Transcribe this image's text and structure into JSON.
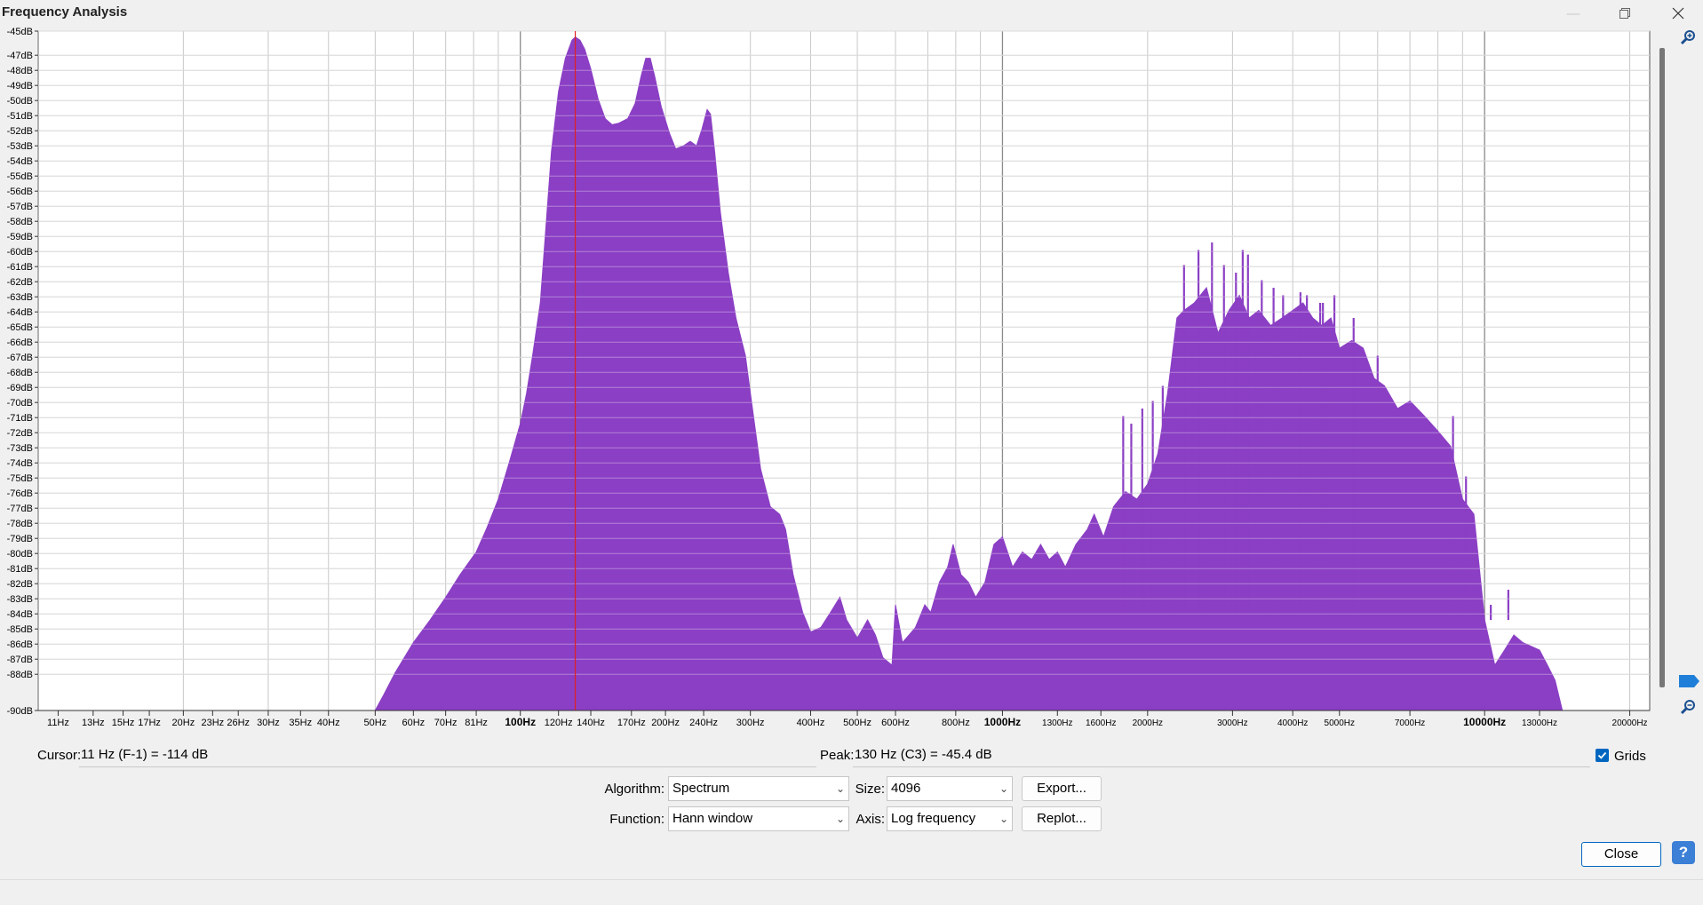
{
  "window": {
    "title": "Frequency Analysis",
    "minimize_icon": "minimize-icon",
    "restore_icon": "restore-icon",
    "close_icon": "close-icon"
  },
  "chart_data": {
    "type": "area",
    "xscale": "log",
    "xlim": [
      10,
      22000
    ],
    "ylim": [
      -90,
      -45
    ],
    "grid": true,
    "fill_color": "#8b3fc4",
    "cursor_color": "#e02020",
    "cursor_x": 130,
    "x_ticks": [
      {
        "v": 11,
        "label": "11Hz",
        "major": false
      },
      {
        "v": 13,
        "label": "13Hz",
        "major": false
      },
      {
        "v": 15,
        "label": "15Hz",
        "major": false
      },
      {
        "v": 17,
        "label": "17Hz",
        "major": false
      },
      {
        "v": 20,
        "label": "20Hz",
        "major": false
      },
      {
        "v": 23,
        "label": "23Hz",
        "major": false
      },
      {
        "v": 26,
        "label": "26Hz",
        "major": false
      },
      {
        "v": 30,
        "label": "30Hz",
        "major": false
      },
      {
        "v": 35,
        "label": "35Hz",
        "major": false
      },
      {
        "v": 40,
        "label": "40Hz",
        "major": false
      },
      {
        "v": 50,
        "label": "50Hz",
        "major": false
      },
      {
        "v": 60,
        "label": "60Hz",
        "major": false
      },
      {
        "v": 70,
        "label": "70Hz",
        "major": false
      },
      {
        "v": 81,
        "label": "81Hz",
        "major": false
      },
      {
        "v": 100,
        "label": "100Hz",
        "major": true
      },
      {
        "v": 120,
        "label": "120Hz",
        "major": false
      },
      {
        "v": 140,
        "label": "140Hz",
        "major": false
      },
      {
        "v": 170,
        "label": "170Hz",
        "major": false
      },
      {
        "v": 200,
        "label": "200Hz",
        "major": false
      },
      {
        "v": 240,
        "label": "240Hz",
        "major": false
      },
      {
        "v": 300,
        "label": "300Hz",
        "major": false
      },
      {
        "v": 400,
        "label": "400Hz",
        "major": false
      },
      {
        "v": 500,
        "label": "500Hz",
        "major": false
      },
      {
        "v": 600,
        "label": "600Hz",
        "major": false
      },
      {
        "v": 800,
        "label": "800Hz",
        "major": false
      },
      {
        "v": 1000,
        "label": "1000Hz",
        "major": true
      },
      {
        "v": 1300,
        "label": "1300Hz",
        "major": false
      },
      {
        "v": 1600,
        "label": "1600Hz",
        "major": false
      },
      {
        "v": 2000,
        "label": "2000Hz",
        "major": false
      },
      {
        "v": 3000,
        "label": "3000Hz",
        "major": false
      },
      {
        "v": 4000,
        "label": "4000Hz",
        "major": false
      },
      {
        "v": 5000,
        "label": "5000Hz",
        "major": false
      },
      {
        "v": 7000,
        "label": "7000Hz",
        "major": false
      },
      {
        "v": 10000,
        "label": "10000Hz",
        "major": true
      },
      {
        "v": 13000,
        "label": "13000Hz",
        "major": false
      },
      {
        "v": 20000,
        "label": "20000Hz",
        "major": false
      }
    ],
    "y_ticks": [
      "-45dB",
      "-47dB",
      "-48dB",
      "-49dB",
      "-50dB",
      "-51dB",
      "-52dB",
      "-53dB",
      "-54dB",
      "-55dB",
      "-56dB",
      "-57dB",
      "-58dB",
      "-59dB",
      "-60dB",
      "-61dB",
      "-62dB",
      "-63dB",
      "-64dB",
      "-65dB",
      "-66dB",
      "-67dB",
      "-68dB",
      "-69dB",
      "-70dB",
      "-71dB",
      "-72dB",
      "-73dB",
      "-74dB",
      "-75dB",
      "-76dB",
      "-77dB",
      "-78dB",
      "-79dB",
      "-80dB",
      "-81dB",
      "-82dB",
      "-83dB",
      "-84dB",
      "-85dB",
      "-86dB",
      "-87dB",
      "-88dB",
      "-90dB"
    ],
    "y_tick_values": [
      -45,
      -46.6,
      -47.6,
      -48.6,
      -49.6,
      -50.6,
      -51.6,
      -52.6,
      -53.6,
      -54.6,
      -55.6,
      -56.6,
      -57.6,
      -58.6,
      -59.6,
      -60.6,
      -61.6,
      -62.6,
      -63.6,
      -64.6,
      -65.6,
      -66.6,
      -67.6,
      -68.6,
      -69.6,
      -70.6,
      -71.6,
      -72.6,
      -73.6,
      -74.6,
      -75.6,
      -76.6,
      -77.6,
      -78.6,
      -79.6,
      -80.6,
      -81.6,
      -82.6,
      -83.6,
      -84.6,
      -85.6,
      -86.6,
      -87.6,
      -90
    ],
    "series_points": [
      [
        50,
        -90
      ],
      [
        52,
        -89
      ],
      [
        55,
        -87.5
      ],
      [
        60,
        -85.5
      ],
      [
        65,
        -84
      ],
      [
        70,
        -82.5
      ],
      [
        75,
        -81
      ],
      [
        81,
        -79.5
      ],
      [
        85,
        -78
      ],
      [
        90,
        -76
      ],
      [
        95,
        -73.5
      ],
      [
        100,
        -71
      ],
      [
        103,
        -69
      ],
      [
        106,
        -66.5
      ],
      [
        110,
        -63
      ],
      [
        113,
        -58
      ],
      [
        116,
        -53
      ],
      [
        120,
        -49
      ],
      [
        124,
        -46.8
      ],
      [
        128,
        -45.6
      ],
      [
        130,
        -45.4
      ],
      [
        133,
        -45.6
      ],
      [
        136,
        -46.2
      ],
      [
        140,
        -47.5
      ],
      [
        145,
        -49.5
      ],
      [
        150,
        -50.8
      ],
      [
        155,
        -51.2
      ],
      [
        160,
        -51.1
      ],
      [
        167,
        -50.8
      ],
      [
        173,
        -49.8
      ],
      [
        178,
        -48
      ],
      [
        182,
        -46.8
      ],
      [
        186,
        -46.8
      ],
      [
        190,
        -48
      ],
      [
        196,
        -50
      ],
      [
        204,
        -51.8
      ],
      [
        210,
        -52.8
      ],
      [
        218,
        -52.6
      ],
      [
        225,
        -52.3
      ],
      [
        232,
        -52.6
      ],
      [
        238,
        -51.5
      ],
      [
        244,
        -50.2
      ],
      [
        248,
        -50.5
      ],
      [
        253,
        -53
      ],
      [
        260,
        -57
      ],
      [
        270,
        -61
      ],
      [
        280,
        -64
      ],
      [
        293,
        -66.5
      ],
      [
        300,
        -69
      ],
      [
        315,
        -74
      ],
      [
        330,
        -76.5
      ],
      [
        345,
        -77
      ],
      [
        355,
        -78
      ],
      [
        368,
        -81
      ],
      [
        385,
        -83.5
      ],
      [
        400,
        -84.8
      ],
      [
        420,
        -84.5
      ],
      [
        440,
        -83.5
      ],
      [
        460,
        -82.5
      ],
      [
        475,
        -84
      ],
      [
        500,
        -85.2
      ],
      [
        525,
        -84
      ],
      [
        545,
        -85
      ],
      [
        565,
        -86.5
      ],
      [
        590,
        -87
      ],
      [
        600,
        -83
      ],
      [
        620,
        -85.5
      ],
      [
        640,
        -85
      ],
      [
        660,
        -84.5
      ],
      [
        690,
        -83
      ],
      [
        710,
        -83.5
      ],
      [
        740,
        -81.5
      ],
      [
        770,
        -80.5
      ],
      [
        790,
        -79
      ],
      [
        820,
        -81
      ],
      [
        850,
        -81.5
      ],
      [
        880,
        -82.5
      ],
      [
        920,
        -81.5
      ],
      [
        960,
        -79
      ],
      [
        1000,
        -78.5
      ],
      [
        1050,
        -80.5
      ],
      [
        1100,
        -79.5
      ],
      [
        1150,
        -80
      ],
      [
        1200,
        -79
      ],
      [
        1250,
        -80
      ],
      [
        1300,
        -79.5
      ],
      [
        1350,
        -80.5
      ],
      [
        1420,
        -79
      ],
      [
        1500,
        -78
      ],
      [
        1550,
        -77
      ],
      [
        1620,
        -78.5
      ],
      [
        1700,
        -76.5
      ],
      [
        1800,
        -75.5
      ],
      [
        1900,
        -76
      ],
      [
        2000,
        -75
      ],
      [
        2100,
        -73
      ],
      [
        2200,
        -69
      ],
      [
        2300,
        -64
      ],
      [
        2380,
        -63.5
      ],
      [
        2500,
        -63
      ],
      [
        2650,
        -62
      ],
      [
        2800,
        -65
      ],
      [
        2950,
        -63.5
      ],
      [
        3100,
        -62.5
      ],
      [
        3250,
        -64
      ],
      [
        3400,
        -63.5
      ],
      [
        3600,
        -64.5
      ],
      [
        3800,
        -64
      ],
      [
        4000,
        -63.5
      ],
      [
        4200,
        -63
      ],
      [
        4400,
        -64
      ],
      [
        4600,
        -64.5
      ],
      [
        4800,
        -64
      ],
      [
        5000,
        -66
      ],
      [
        5300,
        -65.5
      ],
      [
        5600,
        -66
      ],
      [
        5900,
        -68
      ],
      [
        6200,
        -68.5
      ],
      [
        6600,
        -70
      ],
      [
        7000,
        -69.5
      ],
      [
        7500,
        -70.5
      ],
      [
        8000,
        -71.5
      ],
      [
        8500,
        -72.5
      ],
      [
        9000,
        -76
      ],
      [
        9500,
        -77
      ],
      [
        10000,
        -84
      ],
      [
        10500,
        -87
      ],
      [
        11000,
        -86
      ],
      [
        11500,
        -85
      ],
      [
        12000,
        -85.5
      ],
      [
        13000,
        -86
      ],
      [
        13500,
        -87
      ],
      [
        14000,
        -88
      ],
      [
        14500,
        -90
      ]
    ],
    "spikes": [
      [
        2380,
        -60.5
      ],
      [
        2550,
        -59.5
      ],
      [
        2720,
        -59
      ],
      [
        2880,
        -60.5
      ],
      [
        3050,
        -61
      ],
      [
        3150,
        -59.5
      ],
      [
        3230,
        -59.8
      ],
      [
        3450,
        -61.5
      ],
      [
        3650,
        -62
      ],
      [
        3820,
        -62.5
      ],
      [
        4150,
        -62.3
      ],
      [
        4280,
        -62.5
      ],
      [
        4560,
        -63
      ],
      [
        4620,
        -63
      ],
      [
        4880,
        -62.5
      ],
      [
        5350,
        -64
      ],
      [
        6000,
        -66.5
      ],
      [
        1780,
        -70.5
      ],
      [
        1850,
        -71
      ],
      [
        1950,
        -70
      ],
      [
        2050,
        -69.5
      ],
      [
        2150,
        -68.5
      ],
      [
        8600,
        -70.5
      ],
      [
        9150,
        -74.5
      ],
      [
        10300,
        -83
      ],
      [
        11200,
        -82
      ],
      [
        11800,
        -84
      ]
    ],
    "peak_label_hint": "Peak at 130 Hz (C3)"
  },
  "info": {
    "cursor_label": "Cursor:",
    "cursor_value": "11 Hz (F-1) = -114 dB",
    "peak_label": "Peak:",
    "peak_value": "130 Hz (C3) = -45.4 dB",
    "grids_label": "Grids",
    "grids_checked": true
  },
  "controls": {
    "algorithm_label": "Algorithm:",
    "algorithm_value": "Spectrum",
    "size_label": "Size:",
    "size_value": "4096",
    "export_label": "Export...",
    "function_label": "Function:",
    "function_value": "Hann window",
    "axis_label": "Axis:",
    "axis_value": "Log frequency",
    "replot_label": "Replot...",
    "close_label": "Close",
    "help_label": "?"
  },
  "colors": {
    "accent": "#0067c0",
    "fill": "#8b3fc4",
    "cursor_line": "#e02020"
  }
}
